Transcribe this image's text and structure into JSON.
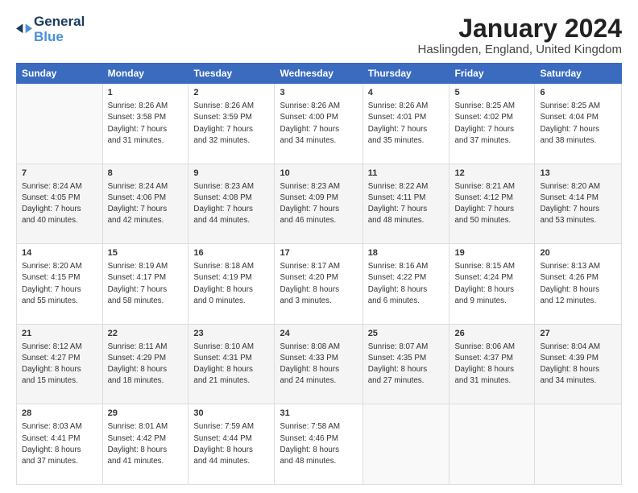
{
  "logo": {
    "line1": "General",
    "line2": "Blue"
  },
  "title": "January 2024",
  "location": "Haslingden, England, United Kingdom",
  "days_of_week": [
    "Sunday",
    "Monday",
    "Tuesday",
    "Wednesday",
    "Thursday",
    "Friday",
    "Saturday"
  ],
  "weeks": [
    [
      {
        "day": "",
        "text": ""
      },
      {
        "day": "1",
        "text": "Sunrise: 8:26 AM\nSunset: 3:58 PM\nDaylight: 7 hours\nand 31 minutes."
      },
      {
        "day": "2",
        "text": "Sunrise: 8:26 AM\nSunset: 3:59 PM\nDaylight: 7 hours\nand 32 minutes."
      },
      {
        "day": "3",
        "text": "Sunrise: 8:26 AM\nSunset: 4:00 PM\nDaylight: 7 hours\nand 34 minutes."
      },
      {
        "day": "4",
        "text": "Sunrise: 8:26 AM\nSunset: 4:01 PM\nDaylight: 7 hours\nand 35 minutes."
      },
      {
        "day": "5",
        "text": "Sunrise: 8:25 AM\nSunset: 4:02 PM\nDaylight: 7 hours\nand 37 minutes."
      },
      {
        "day": "6",
        "text": "Sunrise: 8:25 AM\nSunset: 4:04 PM\nDaylight: 7 hours\nand 38 minutes."
      }
    ],
    [
      {
        "day": "7",
        "text": "Sunrise: 8:24 AM\nSunset: 4:05 PM\nDaylight: 7 hours\nand 40 minutes."
      },
      {
        "day": "8",
        "text": "Sunrise: 8:24 AM\nSunset: 4:06 PM\nDaylight: 7 hours\nand 42 minutes."
      },
      {
        "day": "9",
        "text": "Sunrise: 8:23 AM\nSunset: 4:08 PM\nDaylight: 7 hours\nand 44 minutes."
      },
      {
        "day": "10",
        "text": "Sunrise: 8:23 AM\nSunset: 4:09 PM\nDaylight: 7 hours\nand 46 minutes."
      },
      {
        "day": "11",
        "text": "Sunrise: 8:22 AM\nSunset: 4:11 PM\nDaylight: 7 hours\nand 48 minutes."
      },
      {
        "day": "12",
        "text": "Sunrise: 8:21 AM\nSunset: 4:12 PM\nDaylight: 7 hours\nand 50 minutes."
      },
      {
        "day": "13",
        "text": "Sunrise: 8:20 AM\nSunset: 4:14 PM\nDaylight: 7 hours\nand 53 minutes."
      }
    ],
    [
      {
        "day": "14",
        "text": "Sunrise: 8:20 AM\nSunset: 4:15 PM\nDaylight: 7 hours\nand 55 minutes."
      },
      {
        "day": "15",
        "text": "Sunrise: 8:19 AM\nSunset: 4:17 PM\nDaylight: 7 hours\nand 58 minutes."
      },
      {
        "day": "16",
        "text": "Sunrise: 8:18 AM\nSunset: 4:19 PM\nDaylight: 8 hours\nand 0 minutes."
      },
      {
        "day": "17",
        "text": "Sunrise: 8:17 AM\nSunset: 4:20 PM\nDaylight: 8 hours\nand 3 minutes."
      },
      {
        "day": "18",
        "text": "Sunrise: 8:16 AM\nSunset: 4:22 PM\nDaylight: 8 hours\nand 6 minutes."
      },
      {
        "day": "19",
        "text": "Sunrise: 8:15 AM\nSunset: 4:24 PM\nDaylight: 8 hours\nand 9 minutes."
      },
      {
        "day": "20",
        "text": "Sunrise: 8:13 AM\nSunset: 4:26 PM\nDaylight: 8 hours\nand 12 minutes."
      }
    ],
    [
      {
        "day": "21",
        "text": "Sunrise: 8:12 AM\nSunset: 4:27 PM\nDaylight: 8 hours\nand 15 minutes."
      },
      {
        "day": "22",
        "text": "Sunrise: 8:11 AM\nSunset: 4:29 PM\nDaylight: 8 hours\nand 18 minutes."
      },
      {
        "day": "23",
        "text": "Sunrise: 8:10 AM\nSunset: 4:31 PM\nDaylight: 8 hours\nand 21 minutes."
      },
      {
        "day": "24",
        "text": "Sunrise: 8:08 AM\nSunset: 4:33 PM\nDaylight: 8 hours\nand 24 minutes."
      },
      {
        "day": "25",
        "text": "Sunrise: 8:07 AM\nSunset: 4:35 PM\nDaylight: 8 hours\nand 27 minutes."
      },
      {
        "day": "26",
        "text": "Sunrise: 8:06 AM\nSunset: 4:37 PM\nDaylight: 8 hours\nand 31 minutes."
      },
      {
        "day": "27",
        "text": "Sunrise: 8:04 AM\nSunset: 4:39 PM\nDaylight: 8 hours\nand 34 minutes."
      }
    ],
    [
      {
        "day": "28",
        "text": "Sunrise: 8:03 AM\nSunset: 4:41 PM\nDaylight: 8 hours\nand 37 minutes."
      },
      {
        "day": "29",
        "text": "Sunrise: 8:01 AM\nSunset: 4:42 PM\nDaylight: 8 hours\nand 41 minutes."
      },
      {
        "day": "30",
        "text": "Sunrise: 7:59 AM\nSunset: 4:44 PM\nDaylight: 8 hours\nand 44 minutes."
      },
      {
        "day": "31",
        "text": "Sunrise: 7:58 AM\nSunset: 4:46 PM\nDaylight: 8 hours\nand 48 minutes."
      },
      {
        "day": "",
        "text": ""
      },
      {
        "day": "",
        "text": ""
      },
      {
        "day": "",
        "text": ""
      }
    ]
  ]
}
